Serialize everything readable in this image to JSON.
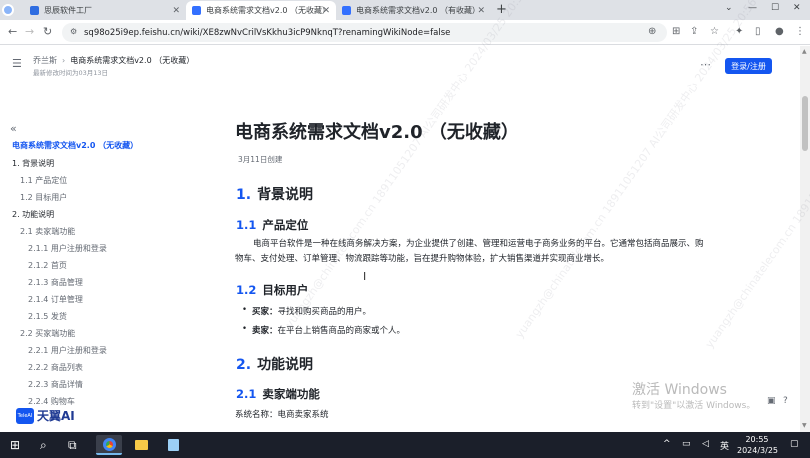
{
  "browser": {
    "tabs": [
      {
        "label": "思辰软件工厂",
        "active": false
      },
      {
        "label": "电商系统需求文档v2.0 （无收藏）",
        "active": true
      },
      {
        "label": "电商系统需求文档v2.0 （有收藏）",
        "active": false
      }
    ],
    "url": "sq98o25i9ep.feishu.cn/wiki/XE8zwNvCrilVsKkhu3icP9NknqT?renamingWikiNode=false"
  },
  "header": {
    "breadcrumb_parent": "乔兰斯",
    "breadcrumb_current": "电商系统需求文档v2.0 （无收藏）",
    "modified": "最新修改时间为03月13日",
    "login_label": "登录/注册"
  },
  "toc": {
    "title": "电商系统需求文档v2.0 （无收藏）",
    "items": [
      {
        "label": "1. 背景说明",
        "level": 1
      },
      {
        "label": "1.1 产品定位",
        "level": 2
      },
      {
        "label": "1.2 目标用户",
        "level": 2
      },
      {
        "label": "2. 功能说明",
        "level": 1
      },
      {
        "label": "2.1 卖家端功能",
        "level": 2
      },
      {
        "label": "2.1.1 用户注册和登录",
        "level": 3
      },
      {
        "label": "2.1.2 首页",
        "level": 3
      },
      {
        "label": "2.1.3 商品管理",
        "level": 3
      },
      {
        "label": "2.1.4 订单管理",
        "level": 3
      },
      {
        "label": "2.1.5 发货",
        "level": 3
      },
      {
        "label": "2.2 买家端功能",
        "level": 2
      },
      {
        "label": "2.2.1 用户注册和登录",
        "level": 3
      },
      {
        "label": "2.2.2 商品列表",
        "level": 3
      },
      {
        "label": "2.2.3 商品详情",
        "level": 3
      },
      {
        "label": "2.2.4 购物车",
        "level": 3
      }
    ]
  },
  "doc": {
    "title": "电商系统需求文档v2.0 （无收藏）",
    "date": "3月11日创建",
    "s1_num": "1.",
    "s1_title": "背景说明",
    "s11_num": "1.1",
    "s11_title": "产品定位",
    "s11_text": "电商平台软件是一种在线商务解决方案，为企业提供了创建、管理和运营电子商务业务的平台。它通常包括商品展示、购物车、支付处理、订单管理、物流跟踪等功能，旨在提升购物体验，扩大销售渠道并实现商业增长。",
    "s12_num": "1.2",
    "s12_title": "目标用户",
    "buyer_label": "买家：",
    "buyer_text": "寻找和购买商品的用户。",
    "seller_label": "卖家：",
    "seller_text": "在平台上销售商品的商家或个人。",
    "s2_num": "2.",
    "s2_title": "功能说明",
    "s21_num": "2.1",
    "s21_title": "卖家端功能",
    "system_name": "系统名称：电商卖家系统"
  },
  "watermark": "yuangzh@chinatelecom.cn 18911051207 AI公司研发中心 2024/03/25 20:56",
  "activation": {
    "title": "激活 Windows",
    "subtitle": "转到\"设置\"以激活 Windows。"
  },
  "brand": {
    "logo_text": "天翼AI",
    "badge_text": "TeleAI"
  },
  "taskbar": {
    "ime": "英",
    "time": "20:55",
    "date": "2024/3/25"
  },
  "colors": {
    "accent": "#1456f0",
    "taskbar": "#1b1f2a"
  }
}
